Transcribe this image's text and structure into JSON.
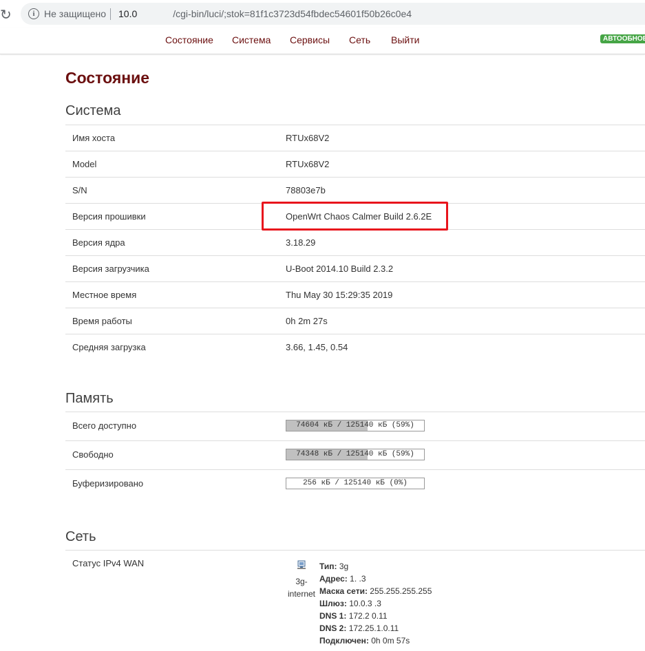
{
  "browser": {
    "insecure_label": "Не защищено",
    "url_host": "10.0",
    "url_path": "/cgi-bin/luci/;stok=81f1c3723d54fbdec54601f50b26c0e4"
  },
  "menu": {
    "items": [
      "Состояние",
      "Система",
      "Сервисы",
      "Сеть",
      "Выйти"
    ],
    "badge": "АВТООБНОВ"
  },
  "page": {
    "title": "Состояние"
  },
  "system": {
    "title": "Система",
    "rows": [
      {
        "label": "Имя хоста",
        "value": "RTUx68V2"
      },
      {
        "label": "Model",
        "value": "RTUx68V2"
      },
      {
        "label": "S/N",
        "value": "78803e7b"
      },
      {
        "label": "Версия прошивки",
        "value": "OpenWrt Chaos Calmer Build 2.6.2E"
      },
      {
        "label": "Версия ядра",
        "value": "3.18.29"
      },
      {
        "label": "Версия загрузчика",
        "value": "U-Boot 2014.10 Build 2.3.2"
      },
      {
        "label": "Местное время",
        "value": "Thu May 30 15:29:35 2019"
      },
      {
        "label": "Время работы",
        "value": "0h 2m 27s"
      },
      {
        "label": "Средняя загрузка",
        "value": "3.66, 1.45, 0.54"
      }
    ]
  },
  "memory": {
    "title": "Память",
    "rows": [
      {
        "label": "Всего доступно",
        "text": "74604 кБ / 125140 кБ (59%)",
        "percent": 59
      },
      {
        "label": "Свободно",
        "text": "74348 кБ / 125140 кБ (59%)",
        "percent": 59
      },
      {
        "label": "Буферизировано",
        "text": "256 кБ / 125140 кБ (0%)",
        "percent": 0
      }
    ]
  },
  "network": {
    "title": "Сеть",
    "wan_label": "Статус IPv4 WAN",
    "iface_icon": "network-interface-icon",
    "iface_name": "3g-internet",
    "details": [
      {
        "key": "Тип:",
        "value": "3g"
      },
      {
        "key": "Адрес:",
        "value": "1.      .3"
      },
      {
        "key": "Маска сети:",
        "value": "255.255.255.255"
      },
      {
        "key": "Шлюз:",
        "value": "10.0.3   .3"
      },
      {
        "key": "DNS 1:",
        "value": "172.2  0.11"
      },
      {
        "key": "DNS 2:",
        "value": "172.25.1.0.11"
      },
      {
        "key": "Подключен:",
        "value": "0h 0m 57s"
      }
    ]
  },
  "colors": {
    "accent": "#6b0f0f",
    "highlight": "#e8141c",
    "badge": "#46a546"
  }
}
